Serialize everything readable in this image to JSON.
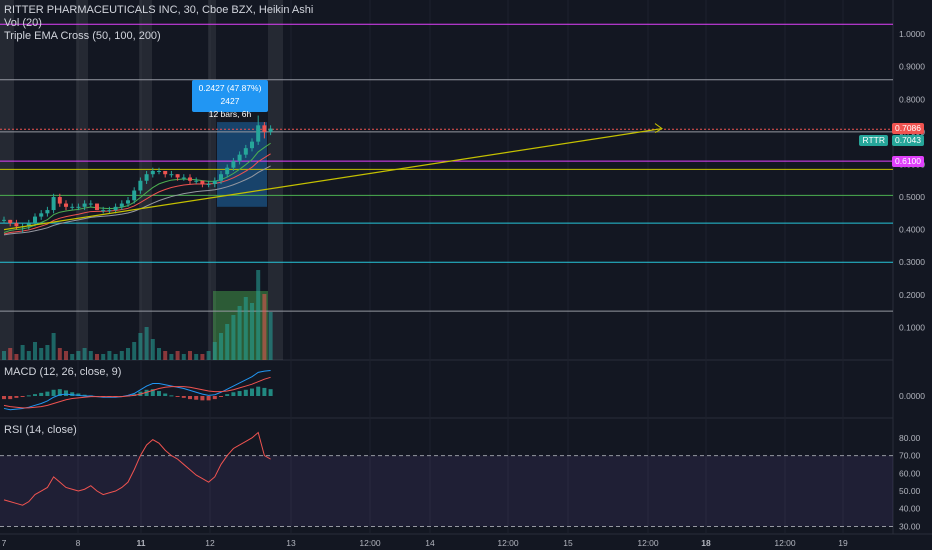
{
  "legend": {
    "title": "RITTER PHARMACEUTICALS INC, 30, Cboe BZX, Heikin Ashi",
    "vol": "Vol (20)",
    "ema": "Triple EMA Cross (50, 100, 200)"
  },
  "tooltip": {
    "line1": "0.2427 (47.87%) 2427",
    "line2": "12 bars, 6h"
  },
  "badges": {
    "price1": "0.7086",
    "ticker": "RTTR",
    "price2": "0.7043",
    "price3": "0.6100"
  },
  "colors": {
    "bg": "#131722",
    "up": "#26a69a",
    "down": "#ef5350",
    "grid": "#1e222d",
    "magenta": "#e040fb",
    "yellowline": "#c5c100",
    "green": "#4caf50",
    "cyan": "#26c6da",
    "gray": "#9598a1"
  },
  "main_axis": {
    "ticks": [
      "1.0000",
      "0.9000",
      "0.8000",
      "0.7000",
      "0.6000",
      "0.5000",
      "0.4000",
      "0.3000",
      "0.2000",
      "0.1000"
    ],
    "values": [
      1.0,
      0.9,
      0.8,
      0.7,
      0.6,
      0.5,
      0.4,
      0.3,
      0.2,
      0.1
    ],
    "ylim": [
      0.0,
      1.08
    ]
  },
  "macd": {
    "label": "MACD (12, 26, close, 9)",
    "tick": "0.0000"
  },
  "rsi": {
    "label": "RSI (14, close)",
    "ticks": [
      "80.00",
      "70.00",
      "60.00",
      "50.00",
      "40.00",
      "30.00"
    ],
    "values": [
      80,
      70,
      60,
      50,
      40,
      30
    ],
    "ylim": [
      28,
      85
    ],
    "bands": [
      70,
      30
    ]
  },
  "time_axis": {
    "labels": [
      "7",
      "8",
      "11",
      "12",
      "13",
      "12:00",
      "14",
      "12:00",
      "15",
      "12:00",
      "18",
      "12:00",
      "19"
    ]
  },
  "horizontal_levels": [
    {
      "price": 1.03,
      "color": "#e040fb"
    },
    {
      "price": 0.86,
      "color": "#9598a1"
    },
    {
      "price": 0.708,
      "color": "#ef5350"
    },
    {
      "price": 0.7,
      "color": "#9598a1"
    },
    {
      "price": 0.61,
      "color": "#e040fb"
    },
    {
      "price": 0.585,
      "color": "#c5c100"
    },
    {
      "price": 0.505,
      "color": "#4caf50"
    },
    {
      "price": 0.42,
      "color": "#26c6da"
    },
    {
      "price": 0.3,
      "color": "#26c6da"
    },
    {
      "price": 0.15,
      "color": "#9598a1"
    }
  ],
  "chart_data": {
    "type": "candlestick",
    "candles": [
      [
        0.43,
        0.44,
        0.42,
        0.43
      ],
      [
        0.43,
        0.43,
        0.41,
        0.42
      ],
      [
        0.42,
        0.43,
        0.4,
        0.41
      ],
      [
        0.41,
        0.42,
        0.39,
        0.41
      ],
      [
        0.41,
        0.43,
        0.4,
        0.42
      ],
      [
        0.42,
        0.45,
        0.41,
        0.44
      ],
      [
        0.44,
        0.46,
        0.43,
        0.45
      ],
      [
        0.45,
        0.47,
        0.44,
        0.46
      ],
      [
        0.46,
        0.51,
        0.45,
        0.5
      ],
      [
        0.5,
        0.51,
        0.47,
        0.48
      ],
      [
        0.48,
        0.49,
        0.46,
        0.47
      ],
      [
        0.47,
        0.48,
        0.46,
        0.47
      ],
      [
        0.47,
        0.48,
        0.46,
        0.47
      ],
      [
        0.47,
        0.49,
        0.46,
        0.48
      ],
      [
        0.48,
        0.49,
        0.47,
        0.48
      ],
      [
        0.48,
        0.48,
        0.46,
        0.46
      ],
      [
        0.46,
        0.47,
        0.45,
        0.46
      ],
      [
        0.46,
        0.47,
        0.45,
        0.46
      ],
      [
        0.46,
        0.48,
        0.45,
        0.47
      ],
      [
        0.47,
        0.49,
        0.46,
        0.48
      ],
      [
        0.48,
        0.5,
        0.47,
        0.49
      ],
      [
        0.49,
        0.53,
        0.48,
        0.52
      ],
      [
        0.52,
        0.56,
        0.51,
        0.55
      ],
      [
        0.55,
        0.58,
        0.54,
        0.57
      ],
      [
        0.57,
        0.59,
        0.56,
        0.58
      ],
      [
        0.58,
        0.59,
        0.57,
        0.58
      ],
      [
        0.58,
        0.58,
        0.56,
        0.57
      ],
      [
        0.57,
        0.58,
        0.56,
        0.57
      ],
      [
        0.57,
        0.57,
        0.55,
        0.56
      ],
      [
        0.56,
        0.57,
        0.55,
        0.56
      ],
      [
        0.56,
        0.57,
        0.54,
        0.55
      ],
      [
        0.55,
        0.56,
        0.54,
        0.55
      ],
      [
        0.55,
        0.55,
        0.53,
        0.54
      ],
      [
        0.54,
        0.55,
        0.53,
        0.54
      ],
      [
        0.54,
        0.56,
        0.53,
        0.55
      ],
      [
        0.55,
        0.58,
        0.54,
        0.57
      ],
      [
        0.57,
        0.6,
        0.56,
        0.59
      ],
      [
        0.59,
        0.62,
        0.58,
        0.61
      ],
      [
        0.61,
        0.64,
        0.6,
        0.63
      ],
      [
        0.63,
        0.66,
        0.62,
        0.65
      ],
      [
        0.65,
        0.68,
        0.64,
        0.67
      ],
      [
        0.67,
        0.75,
        0.66,
        0.72
      ],
      [
        0.72,
        0.73,
        0.68,
        0.7
      ],
      [
        0.7,
        0.72,
        0.69,
        0.71
      ]
    ],
    "volumes": [
      3,
      4,
      2,
      5,
      3,
      6,
      4,
      5,
      9,
      4,
      3,
      2,
      3,
      4,
      3,
      2,
      2,
      3,
      2,
      3,
      4,
      6,
      9,
      11,
      7,
      4,
      3,
      2,
      3,
      2,
      3,
      2,
      2,
      3,
      6,
      9,
      12,
      15,
      18,
      21,
      19,
      30,
      22,
      16
    ],
    "rsi_values": [
      45,
      44,
      43,
      42,
      44,
      48,
      50,
      52,
      58,
      55,
      52,
      51,
      50,
      51,
      53,
      50,
      48,
      49,
      50,
      52,
      55,
      62,
      70,
      76,
      79,
      77,
      73,
      70,
      68,
      65,
      62,
      59,
      57,
      55,
      58,
      65,
      70,
      74,
      76,
      78,
      80,
      83,
      70,
      68
    ],
    "macd_line": [
      -0.02,
      -0.022,
      -0.021,
      -0.02,
      -0.018,
      -0.015,
      -0.012,
      -0.008,
      -0.002,
      0.002,
      0.003,
      0.002,
      0.001,
      0.0,
      0.0,
      -0.001,
      -0.002,
      -0.002,
      -0.002,
      -0.001,
      0.001,
      0.004,
      0.01,
      0.016,
      0.02,
      0.02,
      0.018,
      0.016,
      0.014,
      0.012,
      0.009,
      0.006,
      0.003,
      0.001,
      0.002,
      0.006,
      0.011,
      0.016,
      0.021,
      0.026,
      0.031,
      0.038,
      0.04,
      0.041
    ],
    "signal_line": [
      -0.015,
      -0.017,
      -0.018,
      -0.019,
      -0.019,
      -0.018,
      -0.017,
      -0.015,
      -0.012,
      -0.009,
      -0.006,
      -0.004,
      -0.003,
      -0.002,
      -0.001,
      -0.001,
      -0.001,
      -0.001,
      -0.001,
      -0.001,
      0.0,
      0.001,
      0.003,
      0.006,
      0.009,
      0.012,
      0.014,
      0.015,
      0.015,
      0.015,
      0.014,
      0.012,
      0.01,
      0.008,
      0.007,
      0.007,
      0.008,
      0.01,
      0.013,
      0.016,
      0.019,
      0.023,
      0.027,
      0.03
    ]
  }
}
